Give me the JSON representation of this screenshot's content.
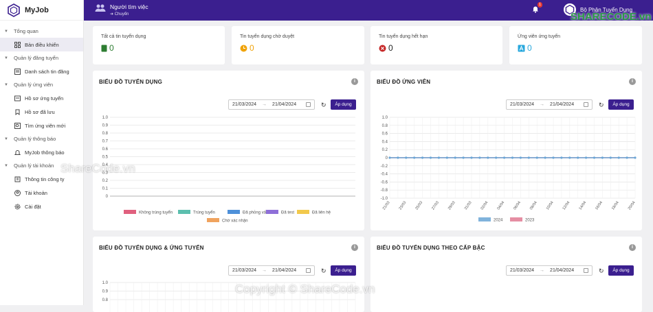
{
  "app": {
    "name": "MyJob"
  },
  "header": {
    "title": "Người tìm việc",
    "subtitle": "➜ Chuyển",
    "notif_count": "1",
    "account_name": "Bộ Phận Tuyển Dụng"
  },
  "sidebar": {
    "groups": [
      {
        "label": "Tổng quan",
        "items": [
          {
            "label": "Bản điều khiển"
          }
        ]
      },
      {
        "label": "Quản lý đăng tuyển",
        "items": [
          {
            "label": "Danh sách tin đăng"
          }
        ]
      },
      {
        "label": "Quản lý ứng viên",
        "items": [
          {
            "label": "Hồ sơ ứng tuyển"
          },
          {
            "label": "Hồ sơ đã lưu"
          },
          {
            "label": "Tìm ứng viên mới"
          }
        ]
      },
      {
        "label": "Quản lý thông báo",
        "items": [
          {
            "label": "MyJob thông báo"
          }
        ]
      },
      {
        "label": "Quản lý tài khoản",
        "items": [
          {
            "label": "Thông tin công ty"
          },
          {
            "label": "Tài khoản"
          },
          {
            "label": "Cài đặt"
          }
        ]
      }
    ]
  },
  "stats": [
    {
      "label": "Tất cả tin tuyển dụng",
      "value": "0",
      "color": "#2e7d32"
    },
    {
      "label": "Tin tuyển dụng chờ duyệt",
      "value": "0",
      "color": "#f0a30a"
    },
    {
      "label": "Tin tuyển dụng hết hạn",
      "value": "0",
      "color": "#c62828"
    },
    {
      "label": "Ứng viên ứng tuyển",
      "value": "0",
      "color": "#29a8dd"
    }
  ],
  "cards": {
    "recruit": {
      "title": "BIỂU ĐỒ TUYỂN DỤNG",
      "date_from": "21/03/2024",
      "date_to": "21/04/2024",
      "apply": "Áp dụng"
    },
    "candidate": {
      "title": "BIỂU ĐỒ ỨNG VIÊN",
      "date_from": "21/03/2024",
      "date_to": "21/04/2024",
      "apply": "Áp dụng"
    },
    "recruit_apply": {
      "title": "BIỂU ĐỒ TUYỂN DỤNG & ỨNG TUYỂN",
      "date_from": "21/03/2024",
      "date_to": "21/04/2024",
      "apply": "Áp dụng"
    },
    "recruit_level": {
      "title": "BIỂU ĐỒ TUYỂN DỤNG THEO CẤP BẬC",
      "date_from": "21/03/2024",
      "date_to": "21/04/2024",
      "apply": "Áp dụng"
    }
  },
  "chart_data": [
    {
      "type": "bar",
      "yticks": [
        "1.0",
        "0.9",
        "0.8",
        "0.7",
        "0.6",
        "0.5",
        "0.4",
        "0.3",
        "0.2",
        "0.1",
        "0"
      ],
      "ylim": [
        0,
        1
      ],
      "series": [
        {
          "name": "Không trúng tuyển",
          "color": "#e0607e",
          "values": []
        },
        {
          "name": "Trúng tuyển",
          "color": "#5cbfae",
          "values": []
        },
        {
          "name": "Đã phỏng vấn",
          "color": "#4e90d9",
          "values": []
        },
        {
          "name": "Đã test",
          "color": "#8e6fd8",
          "values": []
        },
        {
          "name": "Đã liên hệ",
          "color": "#f2c94c",
          "values": []
        },
        {
          "name": "Chờ xác nhận",
          "color": "#f0a35e",
          "values": []
        }
      ]
    },
    {
      "type": "line",
      "yticks": [
        "1.0",
        "0.8",
        "0.6",
        "0.4",
        "0.2",
        "0",
        "-0.2",
        "-0.4",
        "-0.6",
        "-0.8",
        "-1.0"
      ],
      "ylim": [
        -1,
        1
      ],
      "x": [
        "21/03",
        "23/03",
        "25/03",
        "27/03",
        "29/03",
        "31/03",
        "02/04",
        "04/04",
        "06/04",
        "08/04",
        "10/04",
        "12/04",
        "14/04",
        "16/04",
        "18/04",
        "20/04"
      ],
      "points_per_series": 31,
      "series": [
        {
          "name": "2024",
          "color": "#6aa6d6",
          "value": 0
        },
        {
          "name": "2023",
          "color": "#e07a93",
          "value": 0
        }
      ]
    },
    {
      "type": "bar",
      "yticks": [
        "1.0",
        "0.9",
        "0.8"
      ],
      "series": []
    }
  ],
  "watermarks": {
    "top": "ShareCode.vn",
    "bottom": "Copyright © ShareCode.vn",
    "brand": "SHARECODE.vn"
  }
}
